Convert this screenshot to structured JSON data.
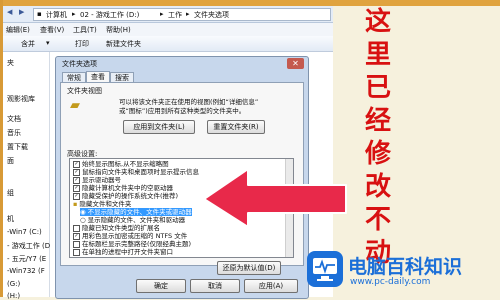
{
  "address": {
    "path": [
      "计算机",
      "02 - 游戏工作 (D:)",
      "工作",
      "文件夹选项"
    ]
  },
  "menu": [
    "编辑(E)",
    "查看(V)",
    "工具(T)",
    "帮助(H)"
  ],
  "toolbar": {
    "organize": "含并",
    "print": "打印",
    "new_folder": "新建文件夹"
  },
  "nav": [
    "夹",
    "观影视库",
    "文档",
    "音乐",
    "置下载",
    "面",
    "组",
    "机",
    "-Win7 (C:)",
    "- 游戏工作 (D",
    "- 五元/Y7 (E",
    "-Win732 (F",
    "(G:)",
    "(H:)"
  ],
  "dialog": {
    "title": "文件夹选项",
    "tabs": [
      "常规",
      "查看",
      "搜索"
    ],
    "section_view": "文件夹视图",
    "desc": [
      "可以将该文件夹正在使用的视图(例如“详细信息”",
      "或“图标”)应用到所有这种类型的文件夹中。"
    ],
    "apply_btn": "应用到文件夹(L)",
    "reset_btn": "重置文件夹(R)",
    "section_adv": "高级设置:",
    "rows": [
      {
        "text": "始终显示图标,从不显示缩略图",
        "checked": true
      },
      {
        "text": "鼠标指向文件夹和桌面项时显示提示信息",
        "checked": true
      },
      {
        "text": "显示驱动器号",
        "checked": true
      },
      {
        "text": "隐藏计算机文件夹中的空驱动器",
        "checked": true
      },
      {
        "text": "隐藏受保护的操作系统文件(推荐)",
        "checked": true
      },
      {
        "text": "隐藏文件和文件夹",
        "checked": false
      },
      {
        "text": "不显示隐藏的文件、文件夹或驱动器",
        "checked": true
      },
      {
        "text": "显示隐藏的文件、文件夹和驱动器",
        "checked": false
      },
      {
        "text": "隐藏已知文件类型的扩展名",
        "checked": false
      },
      {
        "text": "用彩色显示加密或压缩的 NTFS 文件",
        "checked": true
      },
      {
        "text": "在标题栏显示完整路径(仅限经典主题)",
        "checked": false
      },
      {
        "text": "在单独的进程中打开文件夹窗口",
        "checked": false
      }
    ],
    "restore_btn": "还原为默认值(D)",
    "ok_btn": "确定",
    "cancel_btn": "取消",
    "apply2_btn": "应用(A)"
  },
  "annotation": {
    "text": [
      "这",
      "里",
      "已",
      "经",
      "修",
      "改",
      "不",
      "动"
    ],
    "color": "#d81111",
    "arrow_color": "#e8294a"
  },
  "logo": {
    "text": "电脑百科知识",
    "url": "www.pc-daily.com",
    "color": "#1b6fd8"
  }
}
